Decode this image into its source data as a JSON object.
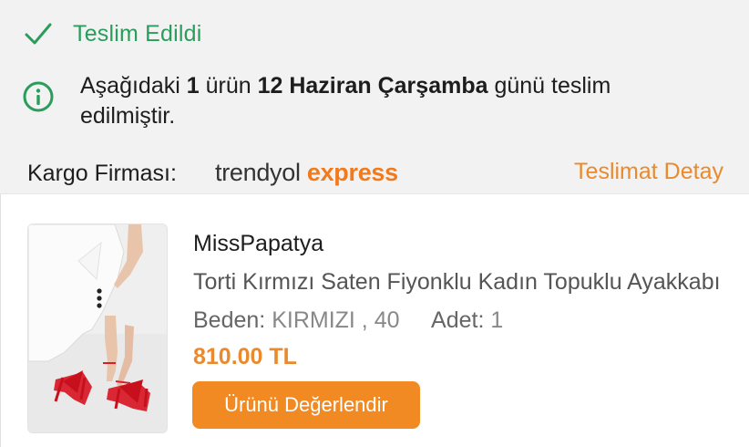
{
  "status": {
    "text": "Teslim Edildi",
    "color": "#2a9d5c",
    "icon": "check-icon"
  },
  "info": {
    "icon": "info-circle-icon",
    "part1": "Aşağıdaki ",
    "count": "1",
    "part2": " ürün ",
    "date": "12 Haziran Çarşamba",
    "part3": " günü teslim edilmiştir."
  },
  "cargo": {
    "label": "Kargo Firması:",
    "brand_part1": "trendyol",
    "brand_part2": "express",
    "detail_link": "Teslimat Detay"
  },
  "product": {
    "seller": "MissPapatya",
    "name": "Torti Kırmızı Saten Fiyonklu Kadın Topuklu Ayakkabı",
    "size_label": "Beden:",
    "size_value": "KIRMIZI , 40",
    "qty_label": "Adet:",
    "qty_value": "1",
    "price": "810.00 TL",
    "review_button": "Ürünü Değerlendir"
  },
  "colors": {
    "accent": "#f28a24",
    "success": "#2a9d5c"
  }
}
